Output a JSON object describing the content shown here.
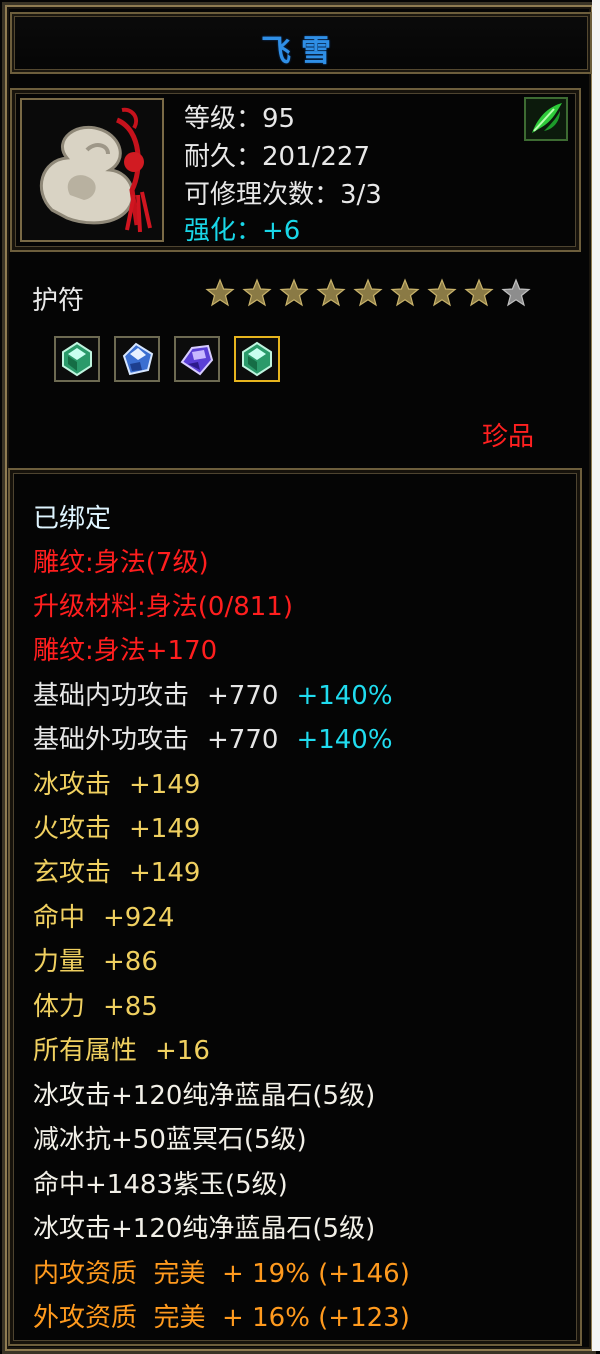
{
  "item": {
    "name": "飞雪",
    "level_label": "等级：95",
    "durability_label": "耐久：201/227",
    "repair_label": "可修理次数：3/3",
    "enhance_label": "强化：+6",
    "category": "护符",
    "rarity": "珍品",
    "stars_filled": 8,
    "stars_total": 9
  },
  "sockets": [
    {
      "icon": "green-gem-icon",
      "selected": false
    },
    {
      "icon": "blue-gem-icon",
      "selected": false
    },
    {
      "icon": "purple-gem-icon",
      "selected": false
    },
    {
      "icon": "green-gem-icon",
      "selected": true
    }
  ],
  "detail": {
    "bound": "已绑定",
    "engrave": "雕纹:身法(7级)",
    "upgrade_material": "升级材料:身法(0/811)",
    "engrave_bonus": "雕纹:身法+170",
    "base_inner_atk": {
      "label": "基础内功攻击",
      "value": "+770",
      "bonus": "+140%"
    },
    "base_outer_atk": {
      "label": "基础外功攻击",
      "value": "+770",
      "bonus": "+140%"
    },
    "attrs": [
      {
        "label": "冰攻击",
        "value": "+149"
      },
      {
        "label": "火攻击",
        "value": "+149"
      },
      {
        "label": "玄攻击",
        "value": "+149"
      },
      {
        "label": "命中",
        "value": "+924"
      },
      {
        "label": "力量",
        "value": "+86"
      },
      {
        "label": "体力",
        "value": "+85"
      },
      {
        "label": "所有属性",
        "value": "+16"
      }
    ],
    "gem_lines": [
      "冰攻击+120纯净蓝晶石(5级)",
      "减冰抗+50蓝冥石(5级)",
      "命中+1483紫玉(5级)",
      "冰攻击+120纯净蓝晶石(5级)"
    ],
    "quality_lines": [
      "内攻资质  完美  + 19% (+146)",
      "外攻资质  完美  + 16% (+123)"
    ]
  },
  "colors": {
    "title": "#2f8fe6",
    "enhance": "#19d7e8",
    "rare": "#ff2020",
    "engrave": "#ff1e1e",
    "attr": "#f0d060",
    "quality": "#ff9a1e",
    "bonus": "#20dcef"
  }
}
